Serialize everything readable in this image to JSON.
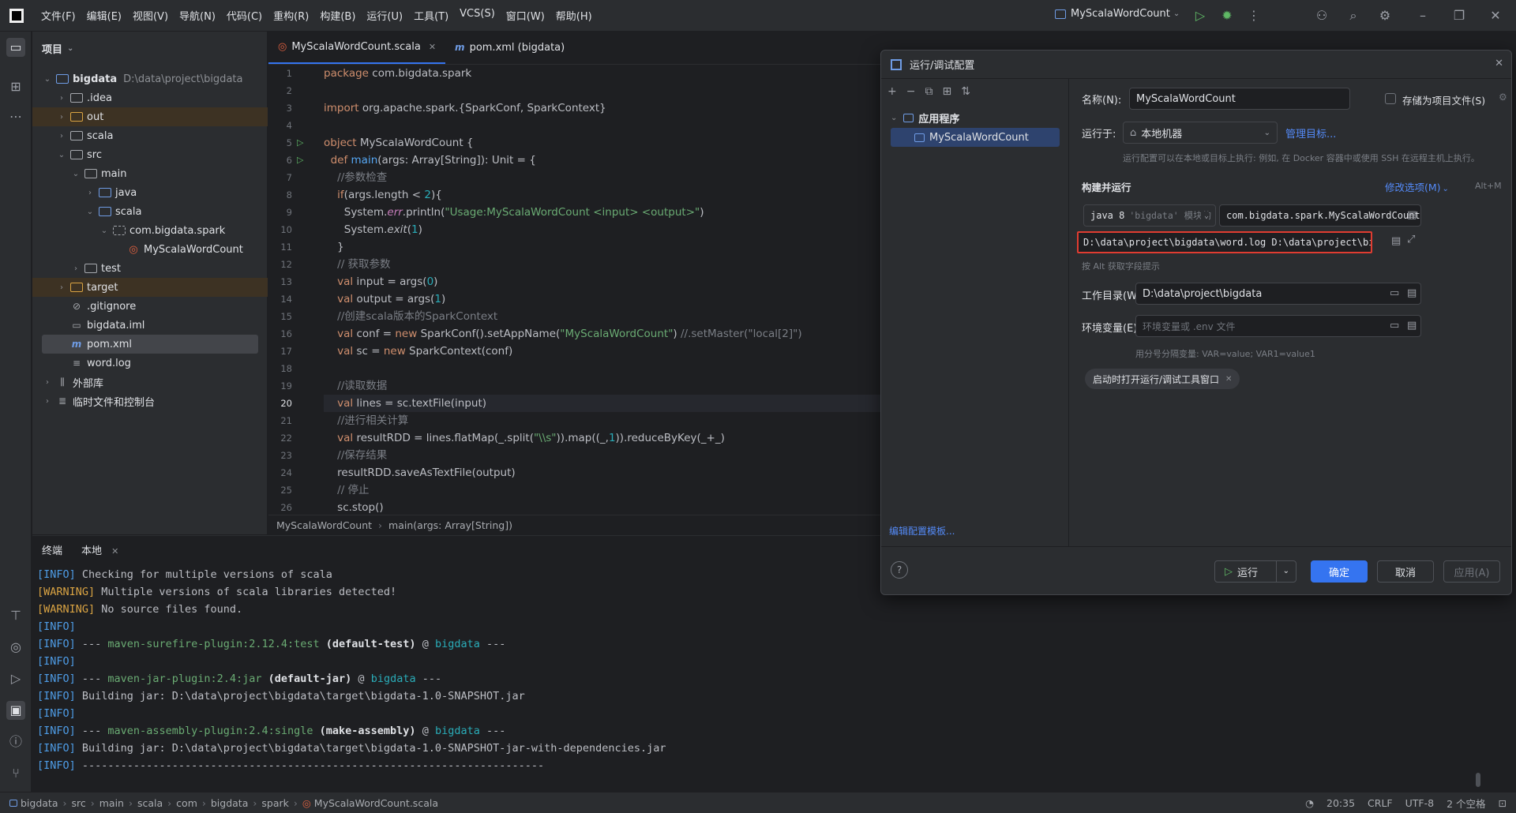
{
  "titlebar": {
    "menus": [
      "文件(F)",
      "编辑(E)",
      "视图(V)",
      "导航(N)",
      "代码(C)",
      "重构(R)",
      "构建(B)",
      "运行(U)",
      "工具(T)",
      "VCS(S)",
      "窗口(W)",
      "帮助(H)"
    ],
    "run_config": "MyScalaWordCount",
    "icons": [
      "run-icon",
      "debug-icon",
      "more-icon",
      "add-user-icon",
      "search-icon",
      "settings-icon",
      "minimize-icon",
      "restore-icon",
      "close-icon"
    ]
  },
  "project": {
    "header": "项目",
    "tree": [
      {
        "label": "bigdata",
        "extra": "D:\\data\\project\\bigdata",
        "icon": "module-folder-icon"
      },
      {
        "label": ".idea",
        "icon": "folder-icon"
      },
      {
        "label": "out",
        "icon": "folder-icon"
      },
      {
        "label": "scala",
        "icon": "folder-icon"
      },
      {
        "label": "src",
        "icon": "folder-icon"
      },
      {
        "label": "main",
        "icon": "folder-icon"
      },
      {
        "label": "java",
        "icon": "source-folder-icon"
      },
      {
        "label": "scala",
        "icon": "source-folder-icon"
      },
      {
        "label": "com.bigdata.spark",
        "icon": "package-icon"
      },
      {
        "label": "MyScalaWordCount",
        "icon": "scala-object-icon"
      },
      {
        "label": "test",
        "icon": "folder-icon"
      },
      {
        "label": "target",
        "icon": "folder-icon"
      },
      {
        "label": ".gitignore",
        "icon": "gitignore-icon"
      },
      {
        "label": "bigdata.iml",
        "icon": "iml-file-icon"
      },
      {
        "label": "pom.xml",
        "icon": "maven-icon"
      },
      {
        "label": "word.log",
        "icon": "text-file-icon"
      },
      {
        "label": "外部库",
        "icon": "library-icon"
      },
      {
        "label": "临时文件和控制台",
        "icon": "scratch-icon"
      }
    ]
  },
  "editor": {
    "tabs": [
      {
        "label": "MyScalaWordCount.scala",
        "icon": "scala-object-icon"
      },
      {
        "label": "pom.xml (bigdata)",
        "icon": "maven-icon"
      }
    ],
    "line_numbers": [
      "1",
      "2",
      "3",
      "4",
      "5",
      "6",
      "7",
      "8",
      "9",
      "10",
      "11",
      "12",
      "13",
      "14",
      "15",
      "16",
      "17",
      "18",
      "19",
      "20",
      "21",
      "22",
      "23",
      "24",
      "25",
      "26"
    ],
    "current_line": "20",
    "breadcrumb": [
      "MyScalaWordCount",
      "main(args: Array[String])"
    ],
    "code": {
      "l1a": "package",
      "l1b": " com.bigdata.spark",
      "l3a": "import",
      "l3b": " org.apache.spark.{SparkConf, SparkContext}",
      "l5a": "object",
      "l5b": " MyScalaWordCount {",
      "l6a": "  def ",
      "l6b": "main",
      "l6c": "(args: Array[String]): Unit = {",
      "l7": "    //参数检查",
      "l8a": "    if",
      "l8b": "(args.length < ",
      "l8c": "2",
      "l8d": "){",
      "l9a": "      System.",
      "l9b": "err",
      "l9c": ".println(",
      "l9d": "\"Usage:MyScalaWordCount <input> <output>\"",
      "l9e": ")",
      "l10a": "      System.",
      "l10b": "exit",
      "l10c": "(",
      "l10d": "1",
      "l10e": ")",
      "l11": "    }",
      "l12": "    // 获取参数",
      "l13a": "    val",
      "l13b": " input = args(",
      "l13c": "0",
      "l13d": ")",
      "l14a": "    val",
      "l14b": " output = args(",
      "l14c": "1",
      "l14d": ")",
      "l15": "    //创建scala版本的SparkContext",
      "l16a": "    val",
      "l16b": " conf = ",
      "l16c": "new",
      "l16d": " SparkConf().setAppName(",
      "l16e": "\"MyScalaWordCount\"",
      "l16f": ") ",
      "l16g": "//.setMaster(\"local[2]\")",
      "l17a": "    val",
      "l17b": " sc = ",
      "l17c": "new",
      "l17d": " SparkContext(conf)",
      "l19": "    //读取数据",
      "l20a": "    val",
      "l20b": " lines = sc.textFile(input)",
      "l21": "    //进行相关计算",
      "l22a": "    val",
      "l22b": " resultRDD = lines.flatMap(_.split(",
      "l22c": "\"\\\\s\"",
      "l22d": ")).map((_,",
      "l22e": "1",
      "l22f": ")).reduceByKey(_+_)",
      "l23": "    //保存结果",
      "l24": "    resultRDD.saveAsTextFile(output)",
      "l25": "    // 停止",
      "l26": "    sc.stop()"
    }
  },
  "terminal": {
    "tabs": [
      "终端",
      "本地"
    ],
    "lines": {
      "t1a": "[INFO]",
      "t1b": " Checking for multiple versions of scala",
      "t2a": "[WARNING]",
      "t2b": " Multiple versions of scala libraries detected!",
      "t3a": "[WARNING]",
      "t3b": " No source files found.",
      "t4a": "[INFO]",
      "t5a": "[INFO]",
      "t5b": " --- ",
      "t5c": "maven-surefire-plugin:2.12.4:test",
      "t5d": " (default-test)",
      "t5e": " @ ",
      "t5f": "bigdata",
      "t5g": " ---",
      "t6a": "[INFO]",
      "t7a": "[INFO]",
      "t7b": " --- ",
      "t7c": "maven-jar-plugin:2.4:jar",
      "t7d": " (default-jar)",
      "t7e": " @ ",
      "t7f": "bigdata",
      "t7g": " ---",
      "t8a": "[INFO]",
      "t8b": " Building jar: D:\\data\\project\\bigdata\\target\\bigdata-1.0-SNAPSHOT.jar",
      "t9a": "[INFO]",
      "t10a": "[INFO]",
      "t10b": " --- ",
      "t10c": "maven-assembly-plugin:2.4:single",
      "t10d": " (make-assembly)",
      "t10e": " @ ",
      "t10f": "bigdata",
      "t10g": " ---",
      "t11a": "[INFO]",
      "t11b": " Building jar: D:\\data\\project\\bigdata\\target\\bigdata-1.0-SNAPSHOT-jar-with-dependencies.jar",
      "t12a": "[INFO]",
      "t12b": " ------------------------------------------------------------------------"
    }
  },
  "statusbar": {
    "path": [
      "bigdata",
      "src",
      "main",
      "scala",
      "com",
      "bigdata",
      "spark",
      "MyScalaWordCount.scala"
    ],
    "position": "20:35",
    "line_sep": "CRLF",
    "encoding": "UTF-8",
    "indent": "2 个空格"
  },
  "dialog": {
    "title": "运行/调试配置",
    "tree_group": "应用程序",
    "tree_item": "MyScalaWordCount",
    "edit_templates": "编辑配置模板...",
    "name_label": "名称(N):",
    "name_value": "MyScalaWordCount",
    "store_as_file": "存储为项目文件(S)",
    "run_on_label": "运行于:",
    "run_on_value": "本地机器",
    "manage_targets": "管理目标...",
    "run_on_hint": "运行配置可以在本地或目标上执行: 例如, 在 Docker 容器中或使用 SSH 在远程主机上执行。",
    "build_run_title": "构建并运行",
    "modify_options": "修改选项(M)",
    "modify_shortcut": "Alt+M",
    "jdk": "java 8",
    "jdk_module": "'bigdata' 模块的 S",
    "main_class": "com.bigdata.spark.MyScalaWordCount",
    "program_args": "D:\\data\\project\\bigdata\\word.log D:\\data\\project\\bigdata\\out",
    "args_hint": "按 Alt 获取字段提示",
    "workdir_label": "工作目录(W):",
    "workdir_value": "D:\\data\\project\\bigdata",
    "env_label": "环境变量(E):",
    "env_placeholder": "环境变量或 .env 文件",
    "env_hint": "用分号分隔变量: VAR=value; VAR1=value1",
    "chip": "启动时打开运行/调试工具窗口",
    "run_button": "运行",
    "ok_button": "确定",
    "cancel_button": "取消",
    "apply_button": "应用(A)",
    "highlight_color": "#e03c31"
  }
}
